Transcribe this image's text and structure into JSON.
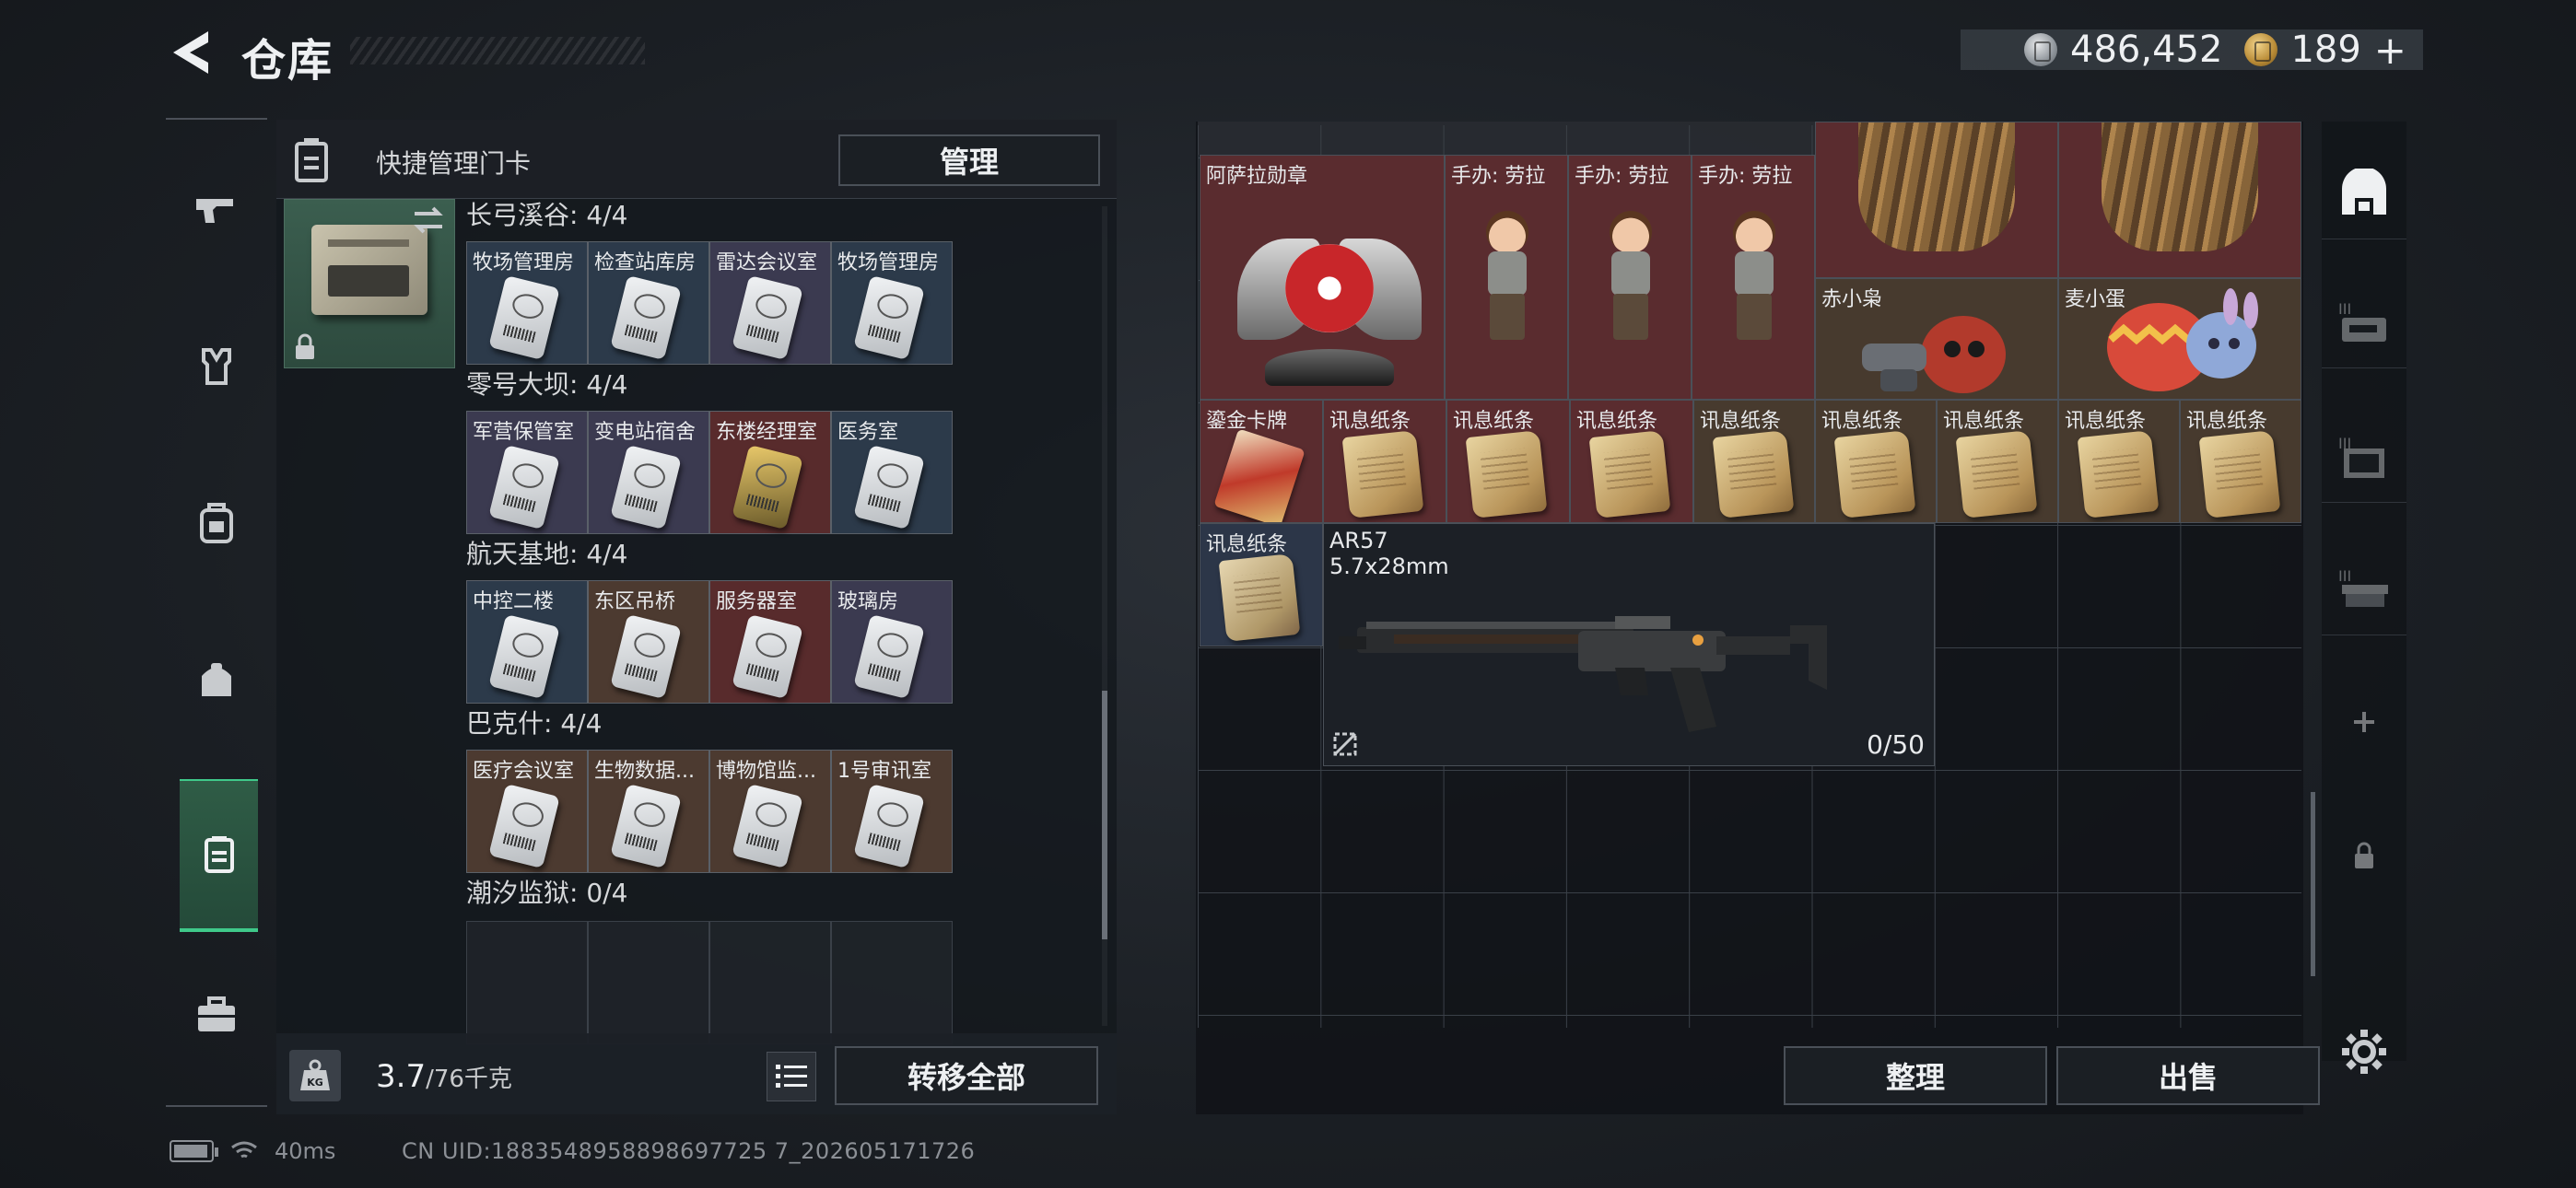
{
  "header": {
    "title": "仓库"
  },
  "currency": {
    "silver": "486,452",
    "gold": "189",
    "plus": "+"
  },
  "left_nav": {
    "items": [
      {
        "icon": "pistol-icon"
      },
      {
        "icon": "armor-icon"
      },
      {
        "icon": "backpack-icon"
      },
      {
        "icon": "bag-icon"
      },
      {
        "icon": "keycard-case-icon",
        "active": true
      },
      {
        "icon": "toolbox-icon"
      }
    ]
  },
  "key_panel": {
    "header_label": "快捷管理门卡",
    "manage_label": "管理",
    "regions": [
      {
        "title": "长弓溪谷: 4/4",
        "cards": [
          {
            "name": "牧场管理房",
            "color": "blue"
          },
          {
            "name": "检查站库房",
            "color": "blue"
          },
          {
            "name": "雷达会议室",
            "color": "purple"
          },
          {
            "name": "牧场管理房",
            "color": "blue"
          }
        ]
      },
      {
        "title": "零号大坝: 4/4",
        "cards": [
          {
            "name": "军营保管室",
            "color": "purple"
          },
          {
            "name": "变电站宿舍",
            "color": "purple"
          },
          {
            "name": "东楼经理室",
            "color": "red"
          },
          {
            "name": "医务室",
            "color": "blue"
          }
        ]
      },
      {
        "title": "航天基地: 4/4",
        "cards": [
          {
            "name": "中控二楼",
            "color": "blue"
          },
          {
            "name": "东区吊桥",
            "color": "brown"
          },
          {
            "name": "服务器室",
            "color": "red"
          },
          {
            "name": "玻璃房",
            "color": "purple"
          }
        ]
      },
      {
        "title": "巴克什: 4/4",
        "cards": [
          {
            "name": "医疗会议室",
            "color": "brown"
          },
          {
            "name": "生物数据...",
            "color": "brown"
          },
          {
            "name": "博物馆监...",
            "color": "brown"
          },
          {
            "name": "1号审讯室",
            "color": "brown"
          }
        ]
      },
      {
        "title": "潮汐监狱: 0/4",
        "cards": []
      }
    ],
    "weight_value": "3.7",
    "weight_cap": "/76千克",
    "weight_badge": "KG",
    "transfer_label": "转移全部"
  },
  "inventory": {
    "medal_name": "阿萨拉勋章",
    "figure_name": "手办: 劳拉",
    "figure_names": [
      "手办: 劳拉",
      "手办: 劳拉",
      "手办: 劳拉"
    ],
    "plush_1": "赤小枭",
    "plush_2": "麦小蛋",
    "gilded_card": "鎏金卡牌",
    "note_name": "讯息纸条",
    "notes": [
      "讯息纸条",
      "讯息纸条",
      "讯息纸条",
      "讯息纸条",
      "讯息纸条",
      "讯息纸条",
      "讯息纸条",
      "讯息纸条"
    ],
    "rifle_name": "AR57",
    "rifle_caliber": "5.7x28mm",
    "rifle_ammo": "0/50",
    "sort_label": "整理",
    "sell_label": "出售"
  },
  "right_tabs": [
    "storage-main-icon",
    "rifle-case-icon",
    "crate-icon",
    "gun-rack-icon",
    "add-icon",
    "lock-icon"
  ],
  "status": {
    "ping": "40ms",
    "uid": "CN UID:1883548958898697725 7_202605171726"
  },
  "colors": {
    "accent_green": "#3fc98a",
    "red_item": "#5a2c2f",
    "brown_item": "#473a2e"
  }
}
